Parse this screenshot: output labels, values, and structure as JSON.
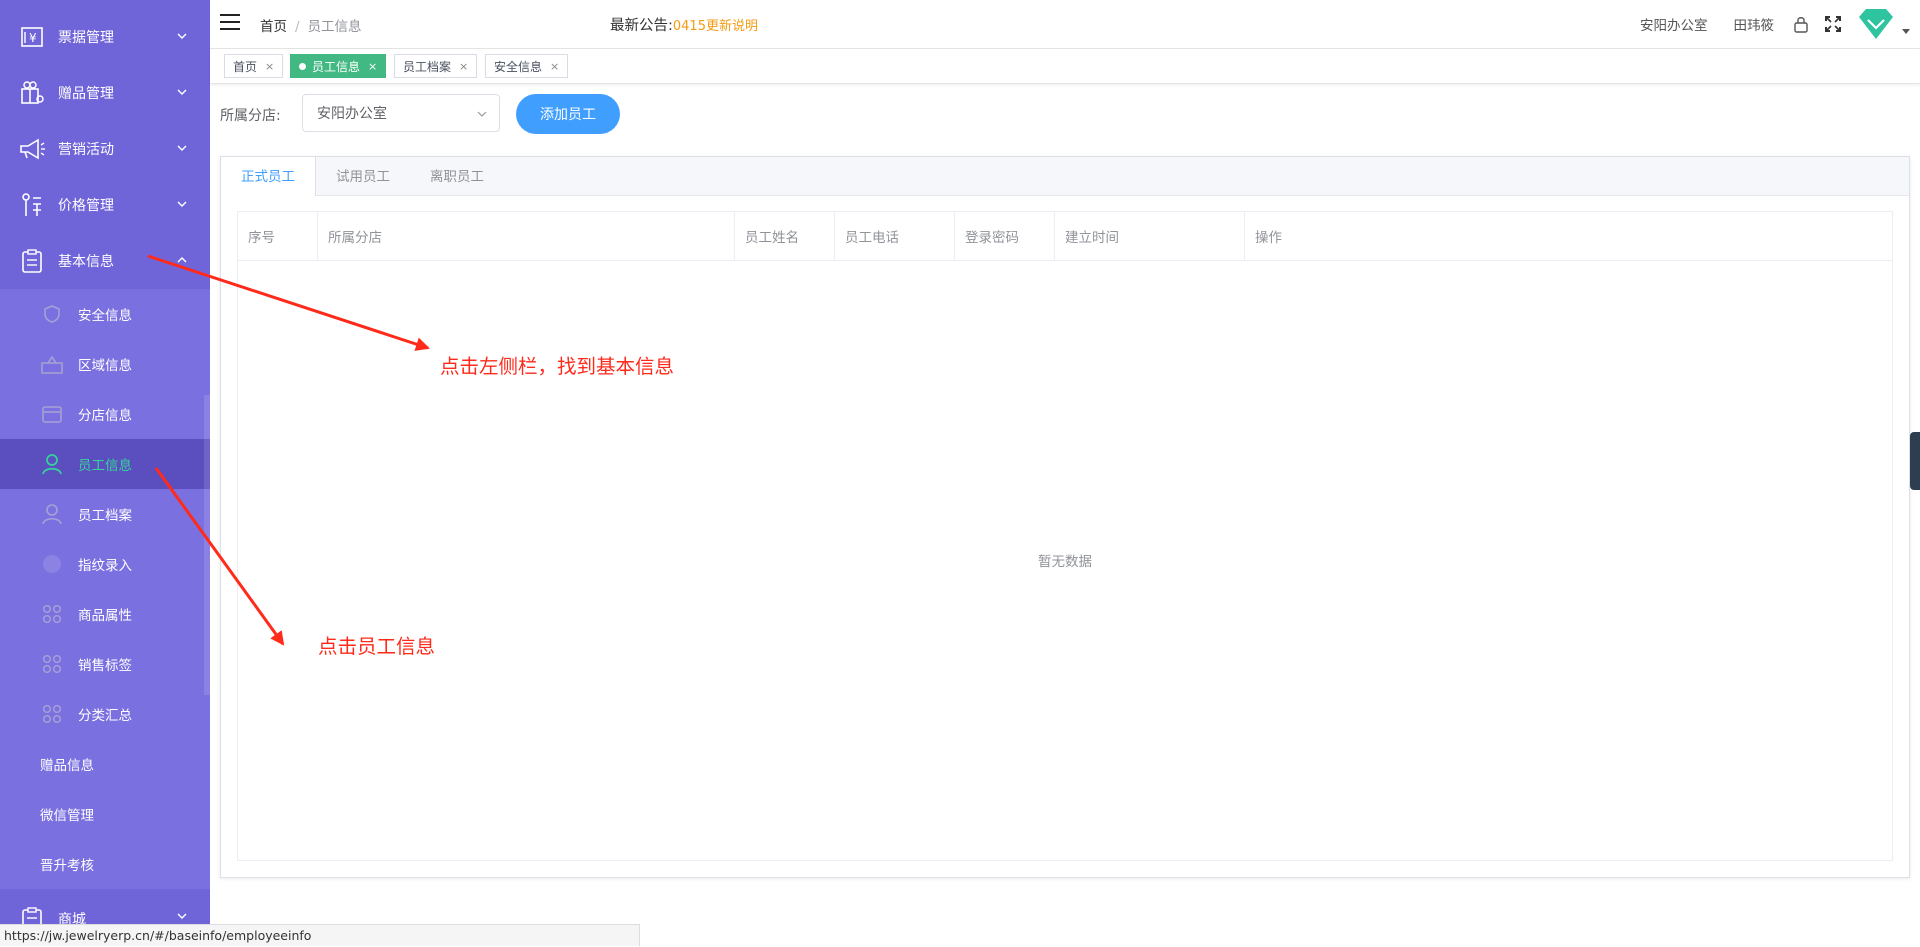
{
  "sidebar": {
    "menus": [
      {
        "label": "票据管理",
        "icon": "receipt-icon"
      },
      {
        "label": "赠品管理",
        "icon": "gift-icon"
      },
      {
        "label": "营销活动",
        "icon": "megaphone-icon"
      },
      {
        "label": "价格管理",
        "icon": "price-icon"
      },
      {
        "label": "基本信息",
        "icon": "clipboard-icon"
      }
    ],
    "submenu": [
      {
        "label": "安全信息",
        "icon": "shield-icon"
      },
      {
        "label": "区域信息",
        "icon": "region-icon"
      },
      {
        "label": "分店信息",
        "icon": "store-icon"
      },
      {
        "label": "员工信息",
        "icon": "user-icon"
      },
      {
        "label": "员工档案",
        "icon": "user-icon"
      },
      {
        "label": "指纹录入",
        "icon": "fingerprint-icon"
      },
      {
        "label": "商品属性",
        "icon": "grid-icon"
      },
      {
        "label": "销售标签",
        "icon": "grid-icon"
      },
      {
        "label": "分类汇总",
        "icon": "grid-icon"
      }
    ],
    "plain": [
      "赠品信息",
      "微信管理",
      "晋升考核"
    ],
    "bottom_menu": {
      "label": "商城",
      "icon": "clipboard-icon"
    },
    "active_color": "#35d39a"
  },
  "header": {
    "breadcrumb": {
      "home": "首页",
      "sep": "/",
      "current": "员工信息"
    },
    "notice": {
      "label": "最新公告:",
      "link": "0415更新说明"
    },
    "branch": "安阳办公室",
    "user": "田玮筱"
  },
  "tags": [
    {
      "label": "首页",
      "close": "×"
    },
    {
      "label": "员工信息",
      "close": "×"
    },
    {
      "label": "员工档案",
      "close": "×"
    },
    {
      "label": "安全信息",
      "close": "×"
    }
  ],
  "filter": {
    "label": "所属分店:",
    "value": "安阳办公室",
    "add_button": "添加员工"
  },
  "content_tabs": [
    "正式员工",
    "试用员工",
    "离职员工"
  ],
  "table": {
    "columns": [
      "序号",
      "所属分店",
      "员工姓名",
      "员工电话",
      "登录密码",
      "建立时间",
      "操作"
    ],
    "empty_text": "暂无数据"
  },
  "annotations": {
    "a1": "点击左侧栏，找到基本信息",
    "a2": "点击员工信息"
  },
  "statusbar": "https://jw.jewelryerp.cn/#/baseinfo/employeeinfo",
  "colors": {
    "sidebar": "#7064d9",
    "primary": "#409eff",
    "tag_active": "#42b983",
    "notice": "#f39c12",
    "annotation": "#ff2a1a"
  }
}
